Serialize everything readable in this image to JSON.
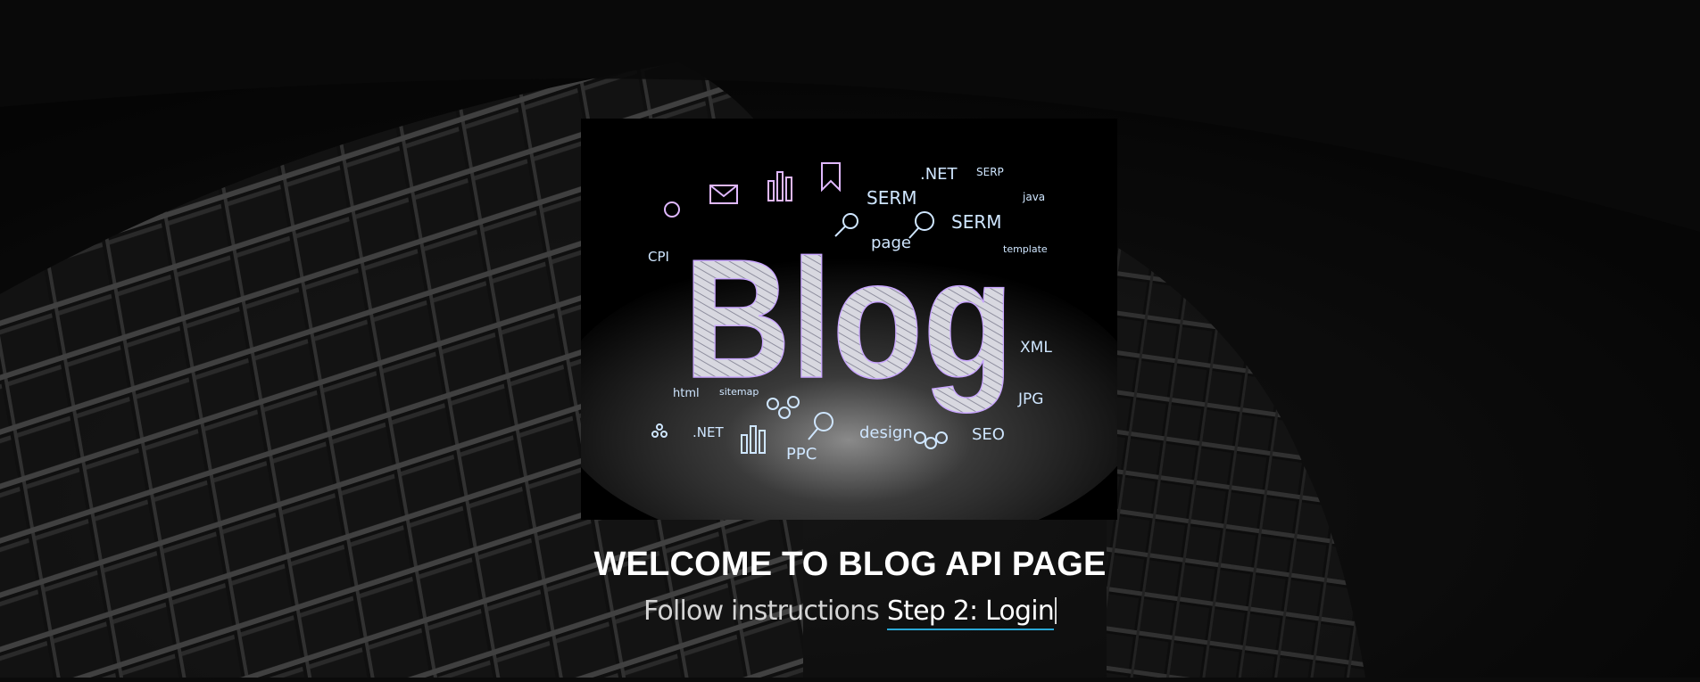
{
  "hero": {
    "image_words": {
      "main": "Blog",
      "dot_net_top": ".NET",
      "serp": "SERP",
      "serm_left": "SERM",
      "serm_right": "SERM",
      "java": "java",
      "page": "page",
      "cpi": "CPI",
      "template": "template",
      "xml": "XML",
      "html": "html",
      "sitemap": "sitemap",
      "jpg": "JPG",
      "dot_net_bottom": ".NET",
      "ppc": "PPC",
      "design": "design",
      "seo": "SEO"
    }
  },
  "welcome": {
    "title": "WELCOME TO BLOG API PAGE",
    "lead_text": "Follow instructions",
    "step_link": "Step 2: Login"
  },
  "colors": {
    "background": "#0b0b0b",
    "title": "#ffffff",
    "subtitle": "#d4d4d4",
    "link_underline": "#2aa8d6"
  }
}
